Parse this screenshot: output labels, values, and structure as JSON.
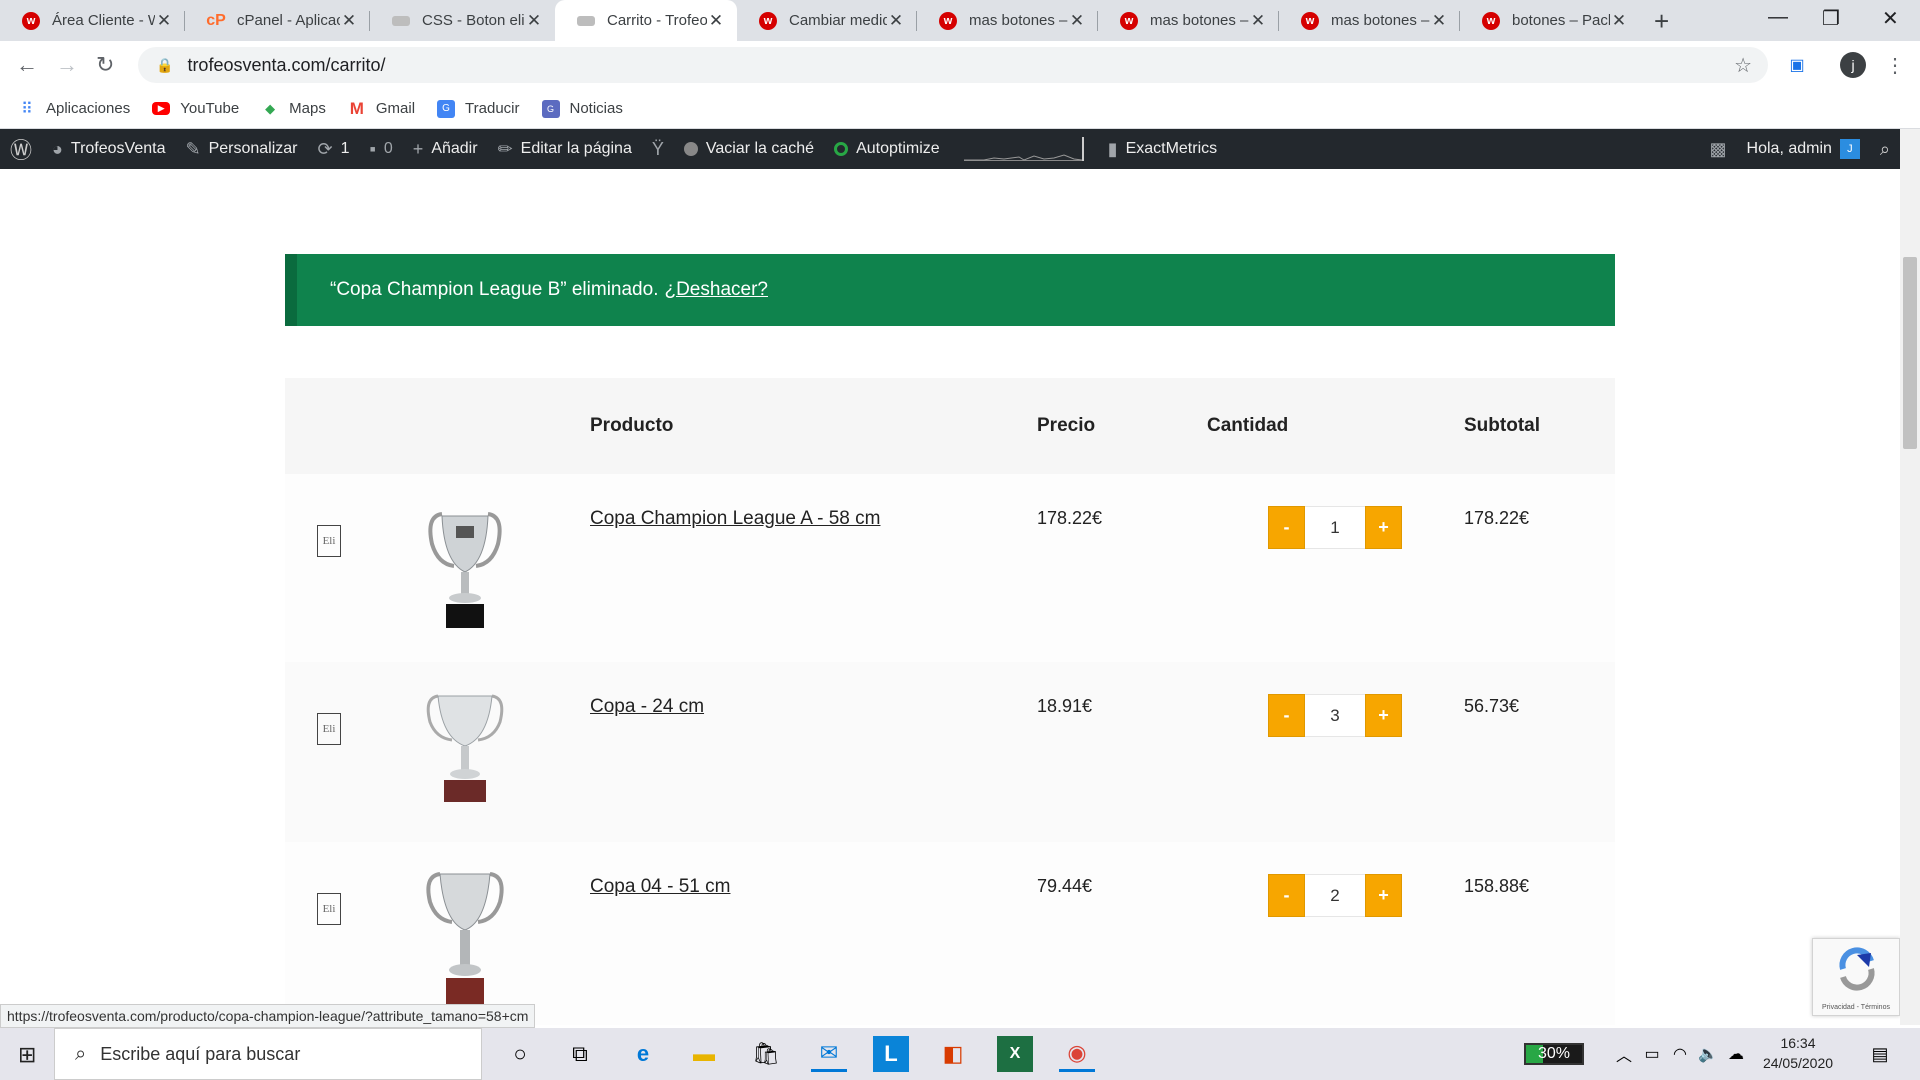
{
  "browser": {
    "tabs": [
      {
        "title": "Área Cliente - W",
        "favicon": "w-brand-icon"
      },
      {
        "title": "cPanel - Aplicac",
        "favicon": "cpanel-icon"
      },
      {
        "title": "CSS - Boton elir",
        "favicon": "css-icon"
      },
      {
        "title": "Carrito - Trofeo",
        "favicon": "css-icon",
        "active": true
      },
      {
        "title": "Cambiar medid",
        "favicon": "w-brand-icon"
      },
      {
        "title": "mas botones –",
        "favicon": "w-brand-icon"
      },
      {
        "title": "mas botones –",
        "favicon": "w-brand-icon"
      },
      {
        "title": "mas botones –",
        "favicon": "w-brand-icon"
      },
      {
        "title": "botones – Pack",
        "favicon": "w-brand-icon"
      }
    ],
    "url": "trofeosventa.com/carrito/",
    "profile_initial": "j"
  },
  "bookmarks": [
    {
      "label": "Aplicaciones",
      "icon": "apps-grid-icon"
    },
    {
      "label": "YouTube",
      "icon": "youtube-icon"
    },
    {
      "label": "Maps",
      "icon": "maps-icon"
    },
    {
      "label": "Gmail",
      "icon": "gmail-icon"
    },
    {
      "label": "Traducir",
      "icon": "translate-icon"
    },
    {
      "label": "Noticias",
      "icon": "news-icon"
    }
  ],
  "adminbar": {
    "site": "TrofeosVenta",
    "customize": "Personalizar",
    "updates": "1",
    "comments": "0",
    "add_new": "Añadir",
    "edit_page": "Editar la página",
    "clear_cache": "Vaciar la caché",
    "autoptimize": "Autoptimize",
    "exactmetrics": "ExactMetrics",
    "greeting": "Hola, admin",
    "avatar_initial": "J"
  },
  "notice": {
    "text": "“Copa Champion League B” eliminado.",
    "undo": "¿Deshacer?"
  },
  "cart": {
    "headers": {
      "product": "Producto",
      "price": "Precio",
      "quantity": "Cantidad",
      "subtotal": "Subtotal"
    },
    "remove_label": "Eli",
    "minus": "-",
    "plus": "+",
    "items": [
      {
        "name": "Copa Champion League A - 58 cm",
        "price": "178.22€",
        "qty": "1",
        "subtotal": "178.22€"
      },
      {
        "name": "Copa - 24 cm",
        "price": "18.91€",
        "qty": "3",
        "subtotal": "56.73€"
      },
      {
        "name": "Copa 04 - 51 cm",
        "price": "79.44€",
        "qty": "2",
        "subtotal": "158.88€"
      }
    ]
  },
  "recaptcha": {
    "privacy": "Privacidad - Términos"
  },
  "status_url": "https://trofeosventa.com/producto/copa-champion-league/?attribute_tamano=58+cm",
  "taskbar": {
    "search_placeholder": "Escribe aquí para buscar",
    "battery": "30%",
    "battery_level": 0.3,
    "time": "16:34",
    "date": "24/05/2020"
  },
  "colors": {
    "notice_bg": "#0f834d",
    "qty_button": "#f7a600",
    "admin_bar": "#23282d"
  }
}
